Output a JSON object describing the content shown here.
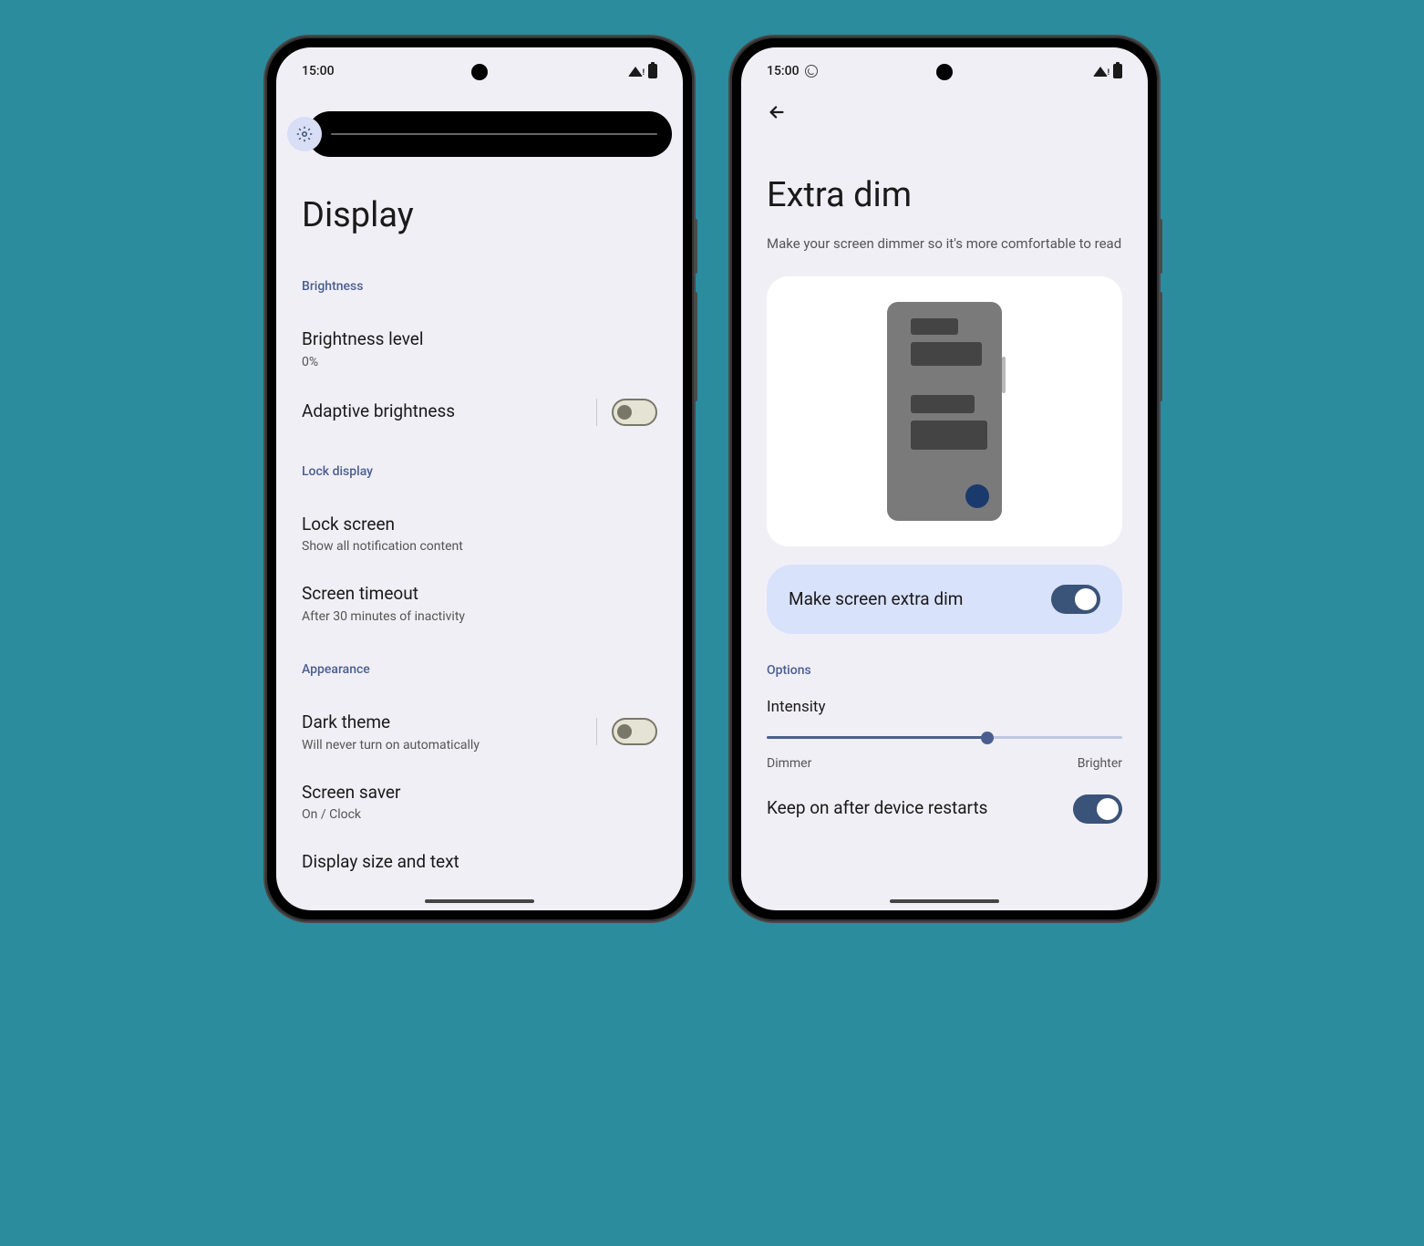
{
  "status": {
    "time": "15:00"
  },
  "phone1": {
    "title": "Display",
    "brightness_pct": 0,
    "sec_brightness": "Brightness",
    "brightness_level": {
      "title": "Brightness level",
      "sub": "0%"
    },
    "adaptive": {
      "title": "Adaptive brightness"
    },
    "sec_lock": "Lock display",
    "lock_screen": {
      "title": "Lock screen",
      "sub": "Show all notification content"
    },
    "timeout": {
      "title": "Screen timeout",
      "sub": "After 30 minutes of inactivity"
    },
    "sec_appearance": "Appearance",
    "dark_theme": {
      "title": "Dark theme",
      "sub": "Will never turn on automatically"
    },
    "screen_saver": {
      "title": "Screen saver",
      "sub": "On / Clock"
    },
    "display_size": {
      "title": "Display size and text"
    }
  },
  "phone2": {
    "title": "Extra dim",
    "subtitle": "Make your screen dimmer so it's more comfortable to read",
    "feature": "Make screen extra dim",
    "sec_options": "Options",
    "intensity": "Intensity",
    "intensity_pct": 62,
    "dimmer": "Dimmer",
    "brighter": "Brighter",
    "keep_on": "Keep on after device restarts"
  }
}
